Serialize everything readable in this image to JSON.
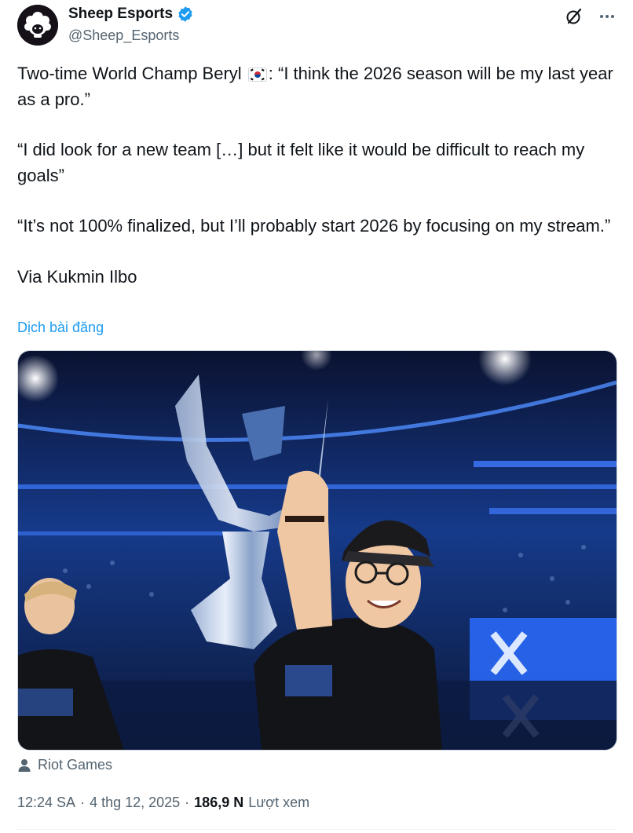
{
  "account": {
    "display_name": "Sheep Esports",
    "handle": "@Sheep_Esports"
  },
  "post": {
    "paragraphs": [
      {
        "before_flag": "Two-time World Champ Beryl ",
        "after_flag": ": “I think the 2026 season will be my last year as a pro.”"
      },
      {
        "text": "“I did look for a new team […] but it felt like it would be difficult to reach my goals”"
      },
      {
        "text": "“It’s not 100% finalized, but I’ll probably start 2026 by focusing on my stream.”"
      },
      {
        "text": "Via Kukmin Ilbo"
      }
    ],
    "translate_label": "Dịch bài đăng",
    "media_credit": "Riot Games",
    "time": "12:24 SA",
    "date": "4 thg 12, 2025",
    "views_count": "186,9 N",
    "views_label": "Lượt xem",
    "separator": "·"
  },
  "icons": {
    "verified": "verified-badge-icon",
    "grok": "grok-icon",
    "more": "more-icon",
    "flag": "south-korea-flag-icon",
    "credit": "person-icon"
  },
  "colors": {
    "link": "#1d9bf0",
    "secondary": "#536471",
    "text": "#0f1419"
  }
}
